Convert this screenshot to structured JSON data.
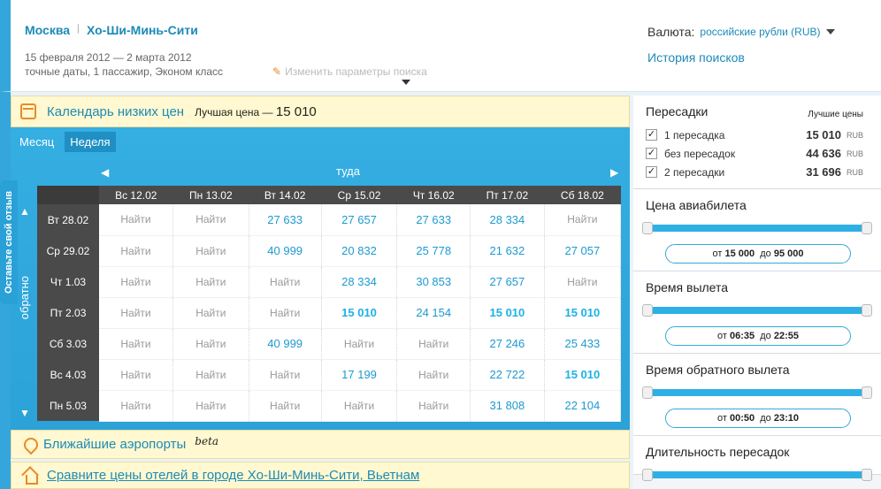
{
  "header": {
    "from": "Москва",
    "to": "Хо-Ши-Минь-Сити",
    "dates": "15 февраля 2012  — 2 марта 2012",
    "params": "точные даты,  1 пассажир,  Эконом класс",
    "edit_label": "Изменить параметры поиска",
    "currency_label": "Валюта:",
    "currency_value": "российские рубли (RUB)",
    "history_label": "История поисков"
  },
  "feedback_label": "Оставьте свой отзыв",
  "calendar": {
    "title": "Календарь низких цен",
    "best_prefix": "Лучшая цена —",
    "best_price": "15 010",
    "tabs": [
      "Месяц",
      "Неделя"
    ],
    "active_tab": "Неделя",
    "direction_out": "туда",
    "direction_back": "обратно",
    "columns": [
      "Вс 12.02",
      "Пн 13.02",
      "Вт 14.02",
      "Ср 15.02",
      "Чт 16.02",
      "Пт 17.02",
      "Сб 18.02"
    ],
    "rows": [
      {
        "date": "Вт 28.02",
        "cells": [
          "Найти",
          "Найти",
          "27 633",
          "27 657",
          "27 633",
          "28 334",
          "Найти"
        ]
      },
      {
        "date": "Ср 29.02",
        "cells": [
          "Найти",
          "Найти",
          "40 999",
          "20 832",
          "25 778",
          "21 632",
          "27 057"
        ]
      },
      {
        "date": "Чт 1.03",
        "cells": [
          "Найти",
          "Найти",
          "Найти",
          "28 334",
          "30 853",
          "27 657",
          "Найти"
        ]
      },
      {
        "date": "Пт 2.03",
        "cells": [
          "Найти",
          "Найти",
          "Найти",
          "15 010",
          "24 154",
          "15 010",
          "15 010"
        ]
      },
      {
        "date": "Сб 3.03",
        "cells": [
          "Найти",
          "Найти",
          "40 999",
          "Найти",
          "Найти",
          "27 246",
          "25 433"
        ]
      },
      {
        "date": "Вс 4.03",
        "cells": [
          "Найти",
          "Найти",
          "Найти",
          "17 199",
          "Найти",
          "22 722",
          "15 010"
        ]
      },
      {
        "date": "Пн 5.03",
        "cells": [
          "Найти",
          "Найти",
          "Найти",
          "Найти",
          "Найти",
          "31 808",
          "22 104"
        ]
      }
    ]
  },
  "airports": {
    "title": "Ближайшие аэропорты",
    "badge": "beta"
  },
  "hotels": {
    "link": "Сравните цены отелей в городе Хо-Ши-Минь-Сити, Вьетнам"
  },
  "sidebar": {
    "stops": {
      "title": "Пересадки",
      "best_label": "Лучшие цены",
      "items": [
        {
          "label": "1 пересадка",
          "price": "15 010",
          "currency": "RUB",
          "checked": "✓"
        },
        {
          "label": "без пересадок",
          "price": "44 636",
          "currency": "RUB",
          "checked": "✓"
        },
        {
          "label": "2 пересадки",
          "price": "31 696",
          "currency": "RUB",
          "checked": "✓"
        }
      ]
    },
    "price": {
      "title": "Цена авиабилета",
      "from_prefix": "от",
      "from": "15 000",
      "to_prefix": "до",
      "to": "95 000"
    },
    "departure": {
      "title": "Время вылета",
      "from_prefix": "от",
      "from": "06:35",
      "to_prefix": "до",
      "to": "22:55"
    },
    "return": {
      "title": "Время обратного вылета",
      "from_prefix": "от",
      "from": "00:50",
      "to_prefix": "до",
      "to": "23:10"
    },
    "layover": {
      "title": "Длительность пересадок"
    }
  },
  "colors": {
    "accent": "#34a6dc",
    "link": "#1d8ab8",
    "best_price": "#1db1e6",
    "banner": "#fff8d0"
  }
}
